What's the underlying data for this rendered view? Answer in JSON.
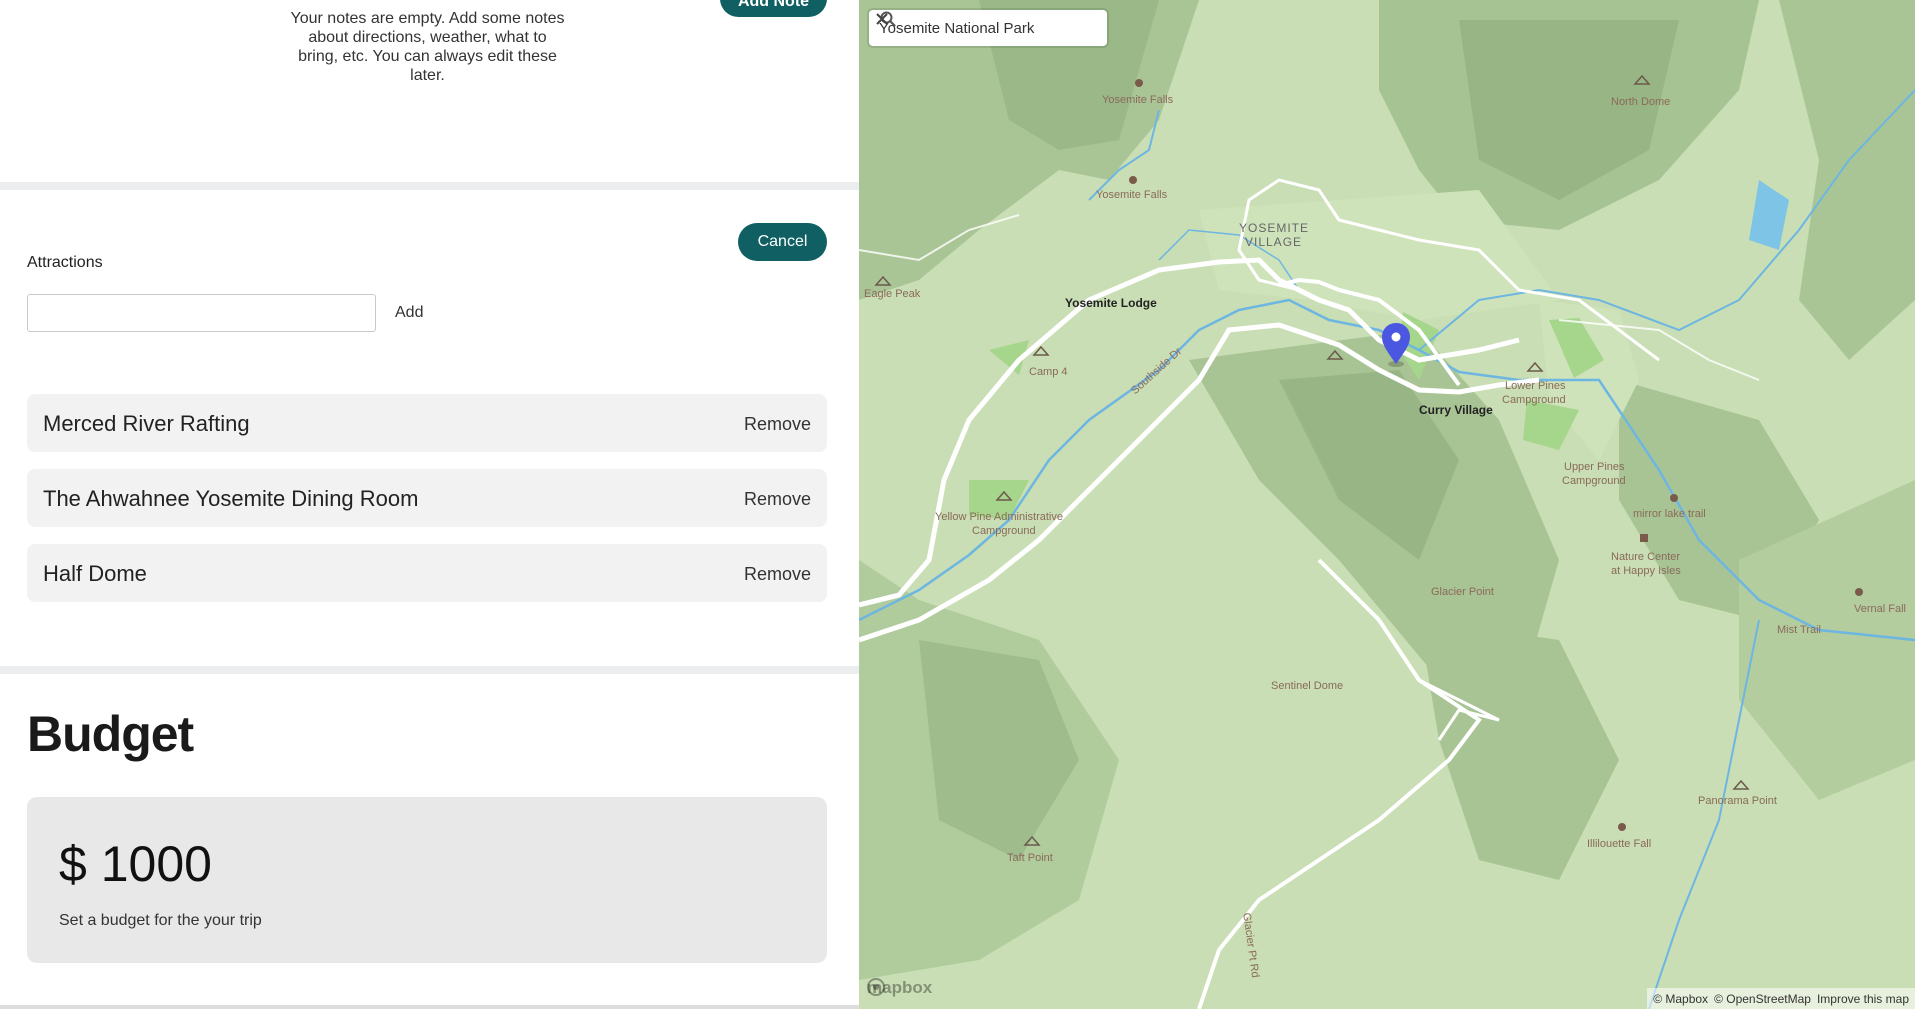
{
  "notes": {
    "add_note_label": "Add Note",
    "empty_message": "Your notes are empty. Add some notes about directions, weather, what to bring, etc. You can always edit these later."
  },
  "attractions": {
    "cancel_label": "Cancel",
    "label": "Attractions",
    "input_value": "",
    "add_label": "Add",
    "remove_label": "Remove",
    "items": [
      {
        "name": "Merced River Rafting"
      },
      {
        "name": "The Ahwahnee Yosemite Dining Room"
      },
      {
        "name": "Half Dome"
      }
    ]
  },
  "budget": {
    "title": "Budget",
    "amount": "$ 1000",
    "note": "Set a budget for the your trip"
  },
  "map": {
    "search_value": "Yosemite National Park",
    "logo_text": "mapbox",
    "attribution": {
      "mapbox": "© Mapbox",
      "osm": "© OpenStreetMap",
      "improve": "Improve this map"
    },
    "marker_color": "#4b57e0",
    "place_labels": {
      "yosemite_falls_upper": "Yosemite Falls",
      "yosemite_falls_lower": "Yosemite Falls",
      "north_dome": "North Dome",
      "yosemite_village_1": "YOSEMITE",
      "yosemite_village_2": "VILLAGE",
      "eagle_peak": "Eagle Peak",
      "yosemite_lodge": "Yosemite Lodge",
      "camp4": "Camp 4",
      "southside_dr": "Southside Dr",
      "curry_village": "Curry Village",
      "lower_pines_1": "Lower Pines",
      "lower_pines_2": "Campground",
      "upper_pines_1": "Upper Pines",
      "upper_pines_2": "Campground",
      "mirror_lake": "mirror lake trail",
      "nature_center_1": "Nature Center",
      "nature_center_2": "at Happy Isles",
      "yellow_pine_1": "Yellow Pine Administrative",
      "yellow_pine_2": "Campground",
      "glacier_point": "Glacier Point",
      "vernal_fall": "Vernal Fall",
      "mist_trail": "Mist Trail",
      "sentinel_dome": "Sentinel Dome",
      "panorama_point": "Panorama Point",
      "illilouette_fall": "Illilouette Fall",
      "taft_point": "Taft Point",
      "glacier_pt_rd": "Glacier Pt Rd"
    }
  }
}
